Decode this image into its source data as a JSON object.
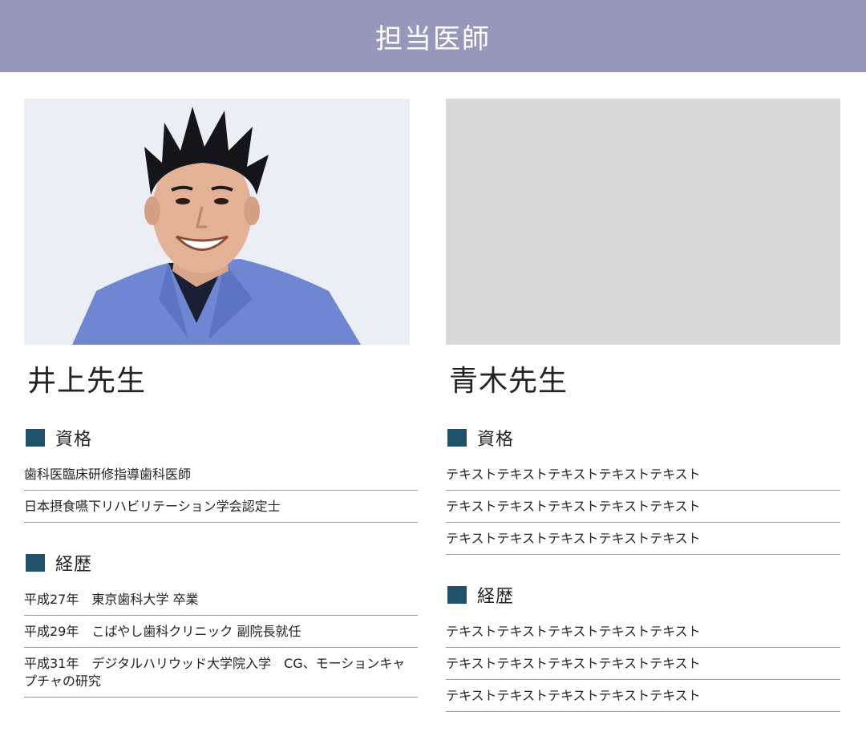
{
  "header": {
    "title": "担当医師"
  },
  "doctors": [
    {
      "name": "井上先生",
      "qualifications_title": "資格",
      "qualifications": [
        "歯科医臨床研修指導歯科医師",
        "日本摂食嚥下リハビリテーション学会認定士"
      ],
      "career_title": "経歴",
      "career": [
        "平成27年　東京歯科大学 卒業",
        "平成29年　こばやし歯科クリニック 副院長就任",
        "平成31年　デジタルハリウッド大学院入学　CG、モーションキャプチャの研究"
      ]
    },
    {
      "name": "青木先生",
      "qualifications_title": "資格",
      "qualifications": [
        "テキストテキストテキストテキストテキスト",
        "テキストテキストテキストテキストテキスト",
        "テキストテキストテキストテキストテキスト"
      ],
      "career_title": "経歴",
      "career": [
        "テキストテキストテキストテキストテキスト",
        "テキストテキストテキストテキストテキスト",
        "テキストテキストテキストテキストテキスト"
      ]
    }
  ],
  "colors": {
    "header_bg": "#9598bb",
    "accent_square": "#1f5169",
    "placeholder_bg": "#d9d9d9",
    "divider": "#9a9a9a"
  }
}
